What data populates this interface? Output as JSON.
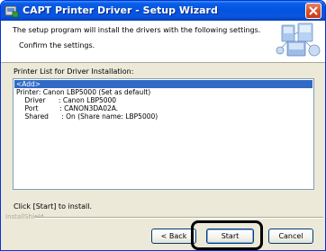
{
  "window": {
    "title": "CAPT Printer Driver - Setup Wizard"
  },
  "header": {
    "main_text": "The setup program will install the drivers with the following settings.",
    "sub_text": "Confirm the settings."
  },
  "list": {
    "label": "Printer List for Driver Installation:",
    "selected_item": "<Add>",
    "lines": [
      "Printer: Canon LBP5000 (Set as default)",
      "    Driver      : Canon LBP5000",
      "    Port          : CANON3DA02A.",
      "    Shared      : On (Share name: LBP5000)"
    ]
  },
  "footer": {
    "instruction": "Click [Start] to install.",
    "brand": "InstallShield"
  },
  "buttons": {
    "back": "< Back",
    "start": "Start",
    "cancel": "Cancel"
  },
  "colors": {
    "titlebar": "#0454e2",
    "selection": "#316ac5",
    "dialog_bg": "#ece9d8"
  },
  "icons": {
    "title": "installer-icon",
    "close": "close-icon",
    "header_graphic": "computer-network-icon"
  }
}
